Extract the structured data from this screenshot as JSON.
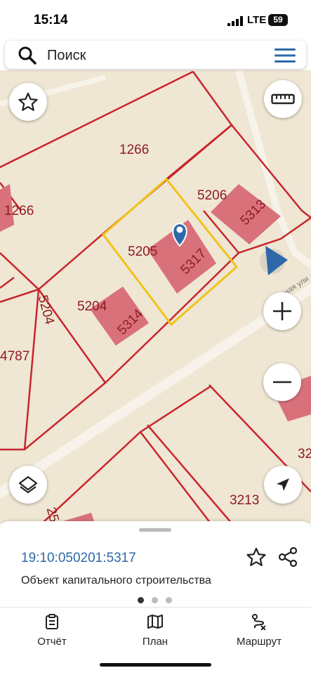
{
  "status_bar": {
    "time": "15:14",
    "network": "LTE",
    "battery": "59"
  },
  "search": {
    "placeholder": "Поиск",
    "search_icon": "search-icon",
    "menu_icon": "menu-icon"
  },
  "map": {
    "plot_labels": [
      "1266",
      "1266",
      "5206",
      "5313",
      "5205",
      "5317",
      "5204",
      "5204",
      "5314",
      "4787",
      "3213",
      "32",
      "25"
    ],
    "street_name": "Лесная ули"
  },
  "selected_object": {
    "cadastral_number": "19:10:050201:5317",
    "type": "Объект капитального строительства"
  },
  "carousel": {
    "count": 3,
    "active": 0
  },
  "tabs": [
    {
      "label": "Отчёт",
      "icon": "report-icon"
    },
    {
      "label": "План",
      "icon": "map-plan-icon"
    },
    {
      "label": "Маршрут",
      "icon": "route-icon"
    }
  ],
  "colors": {
    "accent": "#2d69a8",
    "boundary": "#c9252d",
    "selected_boundary": "#f0c419",
    "building": "#d9717a",
    "map_bg": "#efe6d3"
  }
}
